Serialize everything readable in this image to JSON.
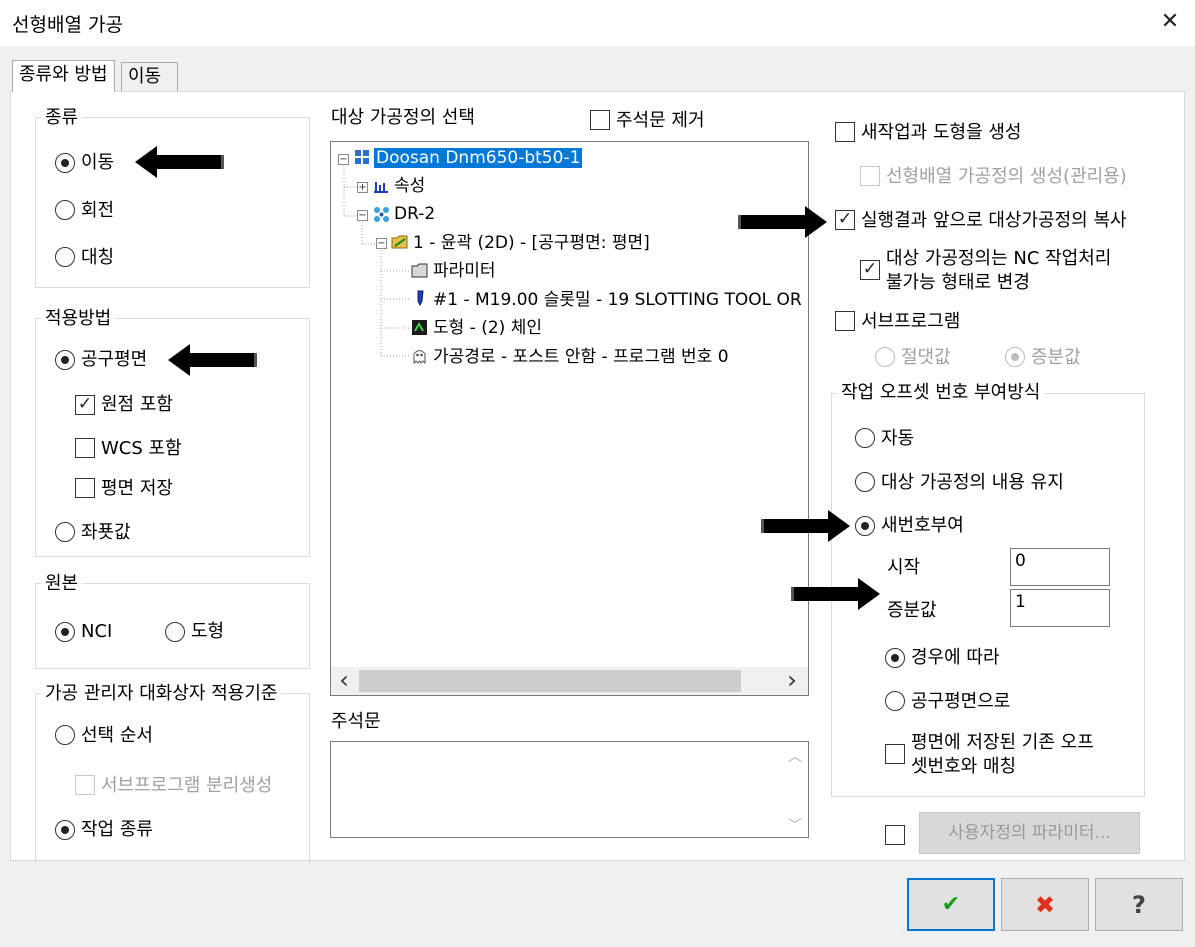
{
  "window": {
    "title": "선형배열 가공",
    "close_glyph": "✕"
  },
  "tabs": [
    {
      "label": "종류와 방법"
    },
    {
      "label": "이동"
    }
  ],
  "type_group": {
    "label": "종류",
    "options": [
      {
        "label": "이동",
        "selected": true
      },
      {
        "label": "회전",
        "selected": false
      },
      {
        "label": "대칭",
        "selected": false
      }
    ]
  },
  "method_group": {
    "label": "적용방법",
    "radio_plane": "공구평면",
    "origin_include": "원점 포함",
    "wcs_include": "WCS 포함",
    "plane_save": "평면 저장",
    "radio_coord": "좌푯값"
  },
  "source_group": {
    "label": "원본",
    "nci": "NCI",
    "geometry": "도형"
  },
  "manager_group": {
    "label": "가공 관리자 대화상자 적용기준",
    "select_order": "선택 순서",
    "subprogram_split": "서브프로그램 분리생성",
    "op_type": "작업 종류"
  },
  "tree_section": {
    "label": "대상 가공정의 선택",
    "remove_comments": "주석문 제거",
    "nodes": [
      {
        "label": "Doosan Dnm650-bt50-1"
      },
      {
        "label": "속성"
      },
      {
        "label": "DR-2"
      },
      {
        "label": "1 - 윤곽 (2D) - [공구평면: 평면]"
      },
      {
        "label": "파라미터"
      },
      {
        "label": "#1 - M19.00 슬롯밀 - 19 SLOTTING TOOL OR"
      },
      {
        "label": "도형 - (2) 체인"
      },
      {
        "label": "가공경로 - 포스트 안함 - 프로그램 번호 0"
      }
    ],
    "scroll_left": "‹",
    "scroll_right": "›"
  },
  "comment_section": {
    "label": "주석문",
    "value": "",
    "scroll_up": "︿",
    "scroll_down": "﹀"
  },
  "right_options": {
    "new_op_geom": "새작업과 도형을 생성",
    "linear_array_op": "선형배열 가공정의 생성(관리용)",
    "copy_op": "실행결과 앞으로 대상가공정의 복사",
    "non_nc_line1": "대상 가공정의는 NC 작업처리",
    "non_nc_line2": "불가능 형태로 변경",
    "subprogram": "서브프로그램",
    "absolute": "절댓값",
    "incremental": "증분값"
  },
  "offset_group": {
    "label": "작업 오프셋 번호 부여방식",
    "auto": "자동",
    "keep": "대상 가공정의 내용 유지",
    "renumber": "새번호부여",
    "start_label": "시작",
    "start_value": "0",
    "increment_label": "증분값",
    "increment_value": "1",
    "case_by_case": "경우에 따라",
    "by_tool_plane": "공구평면으로",
    "match_line1": "평면에 저장된 기존 오프",
    "match_line2": "셋번호와 매칭"
  },
  "custom_params": {
    "label": "사용자정의 파라미터..."
  },
  "footer": {
    "ok_glyph": "✔",
    "cancel_glyph": "✖",
    "help_glyph": "?"
  },
  "colors": {
    "accent": "#0078d7",
    "ok": "#1a9a1a",
    "cancel": "#e0301e"
  }
}
